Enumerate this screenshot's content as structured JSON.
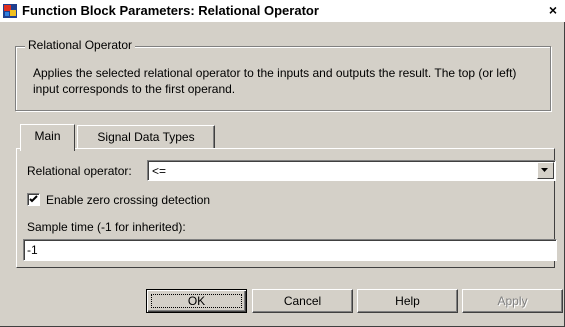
{
  "window": {
    "title": "Function Block Parameters: Relational Operator",
    "close_label": "×"
  },
  "group": {
    "label": "Relational Operator",
    "description": "Applies the selected relational operator to the inputs and outputs the result. The top (or left) input corresponds to the first operand."
  },
  "tabs": [
    {
      "label": "Main",
      "active": true
    },
    {
      "label": "Signal Data Types",
      "active": false
    }
  ],
  "main": {
    "relop_label": "Relational operator:",
    "relop_value": "<=",
    "zero_crossing_label": "Enable zero crossing detection",
    "zero_crossing_checked": true,
    "sample_time_label": "Sample time (-1 for inherited):",
    "sample_time_value": "-1"
  },
  "buttons": {
    "ok": "OK",
    "cancel": "Cancel",
    "help": "Help",
    "apply": "Apply"
  },
  "icons": {
    "app": "simulink-block-icon",
    "close": "close-icon",
    "dropdown": "chevron-down-icon",
    "check": "checkmark-icon"
  },
  "colors": {
    "dialog_bg": "#d4d0c8",
    "disabled_text": "#808080"
  }
}
